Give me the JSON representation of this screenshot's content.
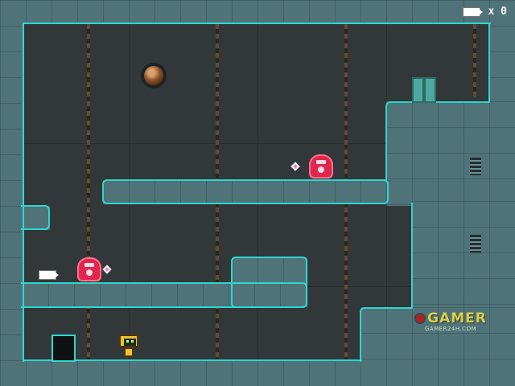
{
  "hud": {
    "collectible_icon": "cartridge-icon",
    "count_text": "x 0"
  },
  "watermark": {
    "brand": "GAMER",
    "domain": "GAMER24H.COM"
  },
  "colors": {
    "wall": "#4f7379",
    "edge": "#2fd6cf",
    "enemy": "#e0264d",
    "player": "#f0c230",
    "background": "#323839"
  },
  "entities": [
    "player-robot",
    "red-robot-enemy-upper",
    "red-robot-enemy-lower",
    "pink-gem-upper",
    "pink-gem-lower",
    "cartridge-pickup",
    "exit-door",
    "entry-door",
    "porthole"
  ]
}
